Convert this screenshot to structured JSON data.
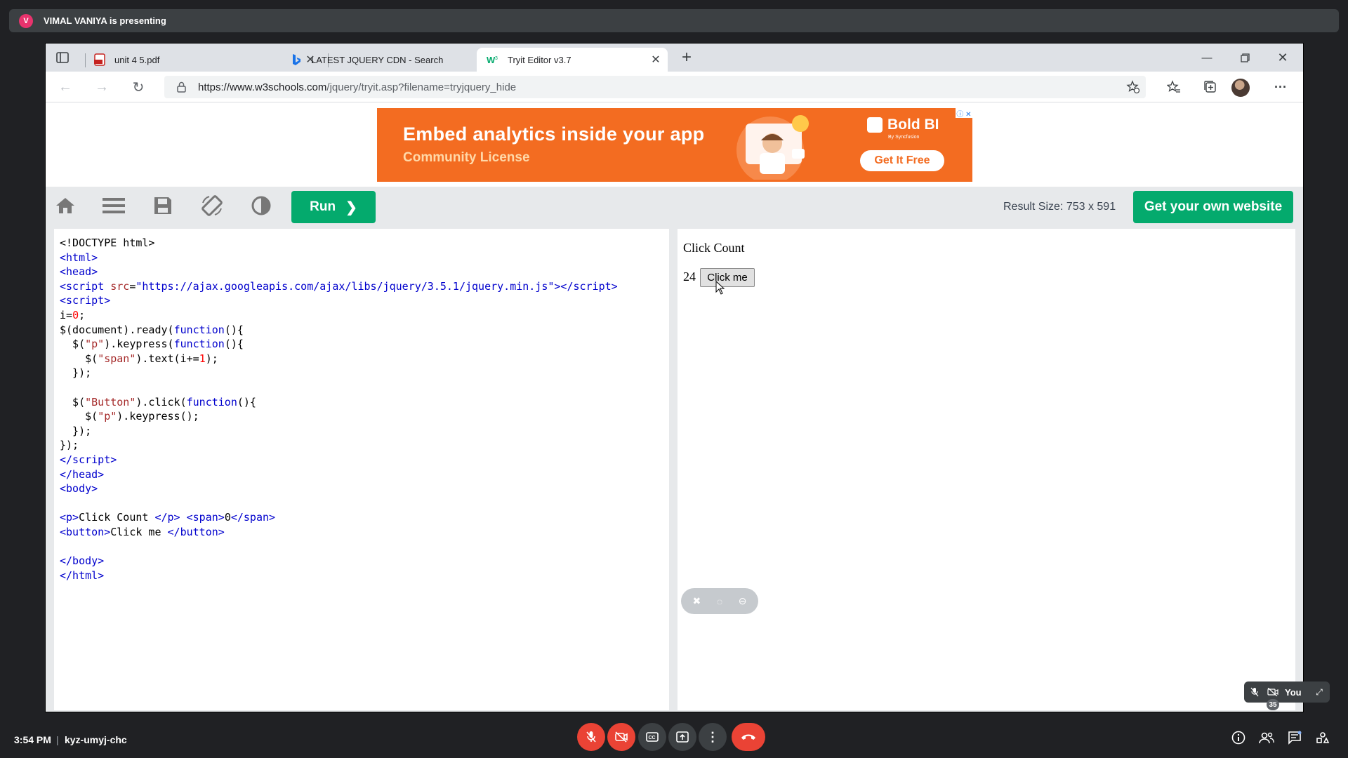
{
  "meet": {
    "presenter_initial": "V",
    "presenter_text": "VIMAL VANIYA is presenting",
    "time": "3:54 PM",
    "separator": "|",
    "meeting_code": "kyz-umyj-chc",
    "self_label": "You",
    "participants_count": "35",
    "colors": {
      "end_call": "#ea4335",
      "bar": "#202124"
    }
  },
  "browser": {
    "tabs": [
      {
        "label": "unit 4 5.pdf",
        "icon": "pdf-icon"
      },
      {
        "label": "LATEST JQUERY CDN - Search",
        "icon": "bing-icon"
      },
      {
        "label": "Tryit Editor v3.7",
        "icon": "w3schools-icon",
        "active": true
      }
    ],
    "url_host": "https://www.w3schools.com",
    "url_path": "/jquery/tryit.asp?filename=tryjquery_hide"
  },
  "ad": {
    "headline": "Embed analytics inside your app",
    "subline": "Community License",
    "brand": "Bold BI",
    "brand_sub": "By Syncfusion",
    "cta": "Get It Free",
    "close": "ⓘ ✕"
  },
  "tryit": {
    "run_label": "Run",
    "run_chevron": "❯",
    "result_size": "Result Size: 753 x 591",
    "own_website": "Get your own website",
    "colors": {
      "accent": "#04aa6d",
      "toolbar": "#e7e9eb"
    }
  },
  "result": {
    "paragraph": "Click Count",
    "count": "24",
    "button_label": "Click me"
  }
}
